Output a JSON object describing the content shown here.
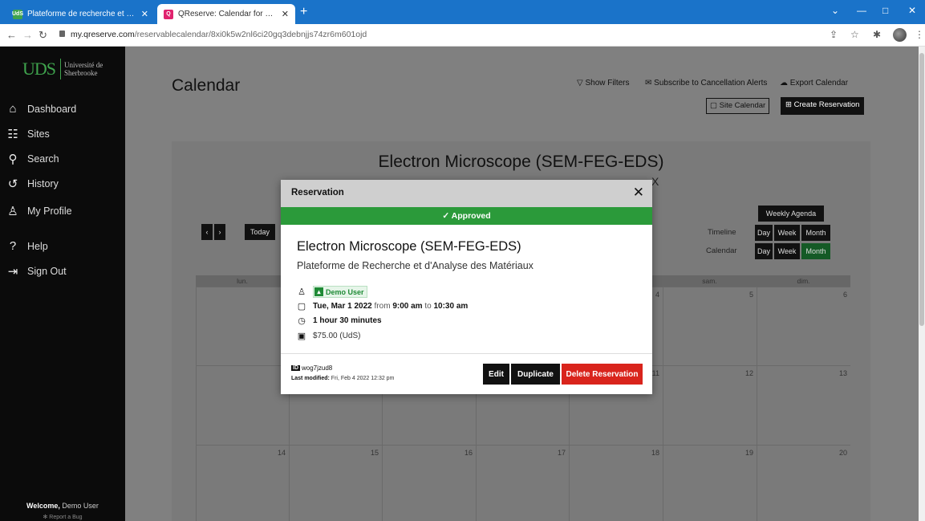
{
  "browser": {
    "tabs": [
      {
        "title": "Plateforme de recherche et d'an",
        "favicon": "UdS"
      },
      {
        "title": "QReserve: Calendar for Electron",
        "favicon": "Q"
      }
    ],
    "url_host": "my.qreserve.com",
    "url_path": "/reservablecalendar/8xi0k5w2nl6ci20gq3debnjjs74zr6m601ojd"
  },
  "sidebar": {
    "logo_mark": "UDS",
    "logo_text": "Université de Sherbrooke",
    "items": [
      {
        "label": "Dashboard",
        "icon": "home-icon"
      },
      {
        "label": "Sites",
        "icon": "sites-icon"
      },
      {
        "label": "Search",
        "icon": "search-icon"
      },
      {
        "label": "History",
        "icon": "history-icon"
      },
      {
        "label": "My Profile",
        "icon": "user-icon"
      },
      {
        "label": "Help",
        "icon": "help-icon"
      },
      {
        "label": "Sign Out",
        "icon": "sign-out-icon"
      }
    ],
    "welcome_prefix": "Welcome,",
    "welcome_user": "Demo User",
    "report_bug": "Report a Bug"
  },
  "header": {
    "title": "Calendar",
    "show_filters": "Show Filters",
    "subscribe": "Subscribe to Cancellation Alerts",
    "export": "Export Calendar",
    "site_calendar": "Site Calendar",
    "create_reservation": "Create Reservation"
  },
  "calendar": {
    "title": "Electron Microscope (SEM-FEG-EDS)",
    "subtitle_fragment": "X",
    "today": "Today",
    "weekly_agenda": "Weekly Agenda",
    "timeline_label": "Timeline",
    "calendar_label": "Calendar",
    "view_day": "Day",
    "view_week": "Week",
    "view_month": "Month",
    "day_headers": [
      "lun.",
      "",
      "",
      "",
      "",
      "sam.",
      "dim."
    ],
    "week1": [
      "",
      "",
      "",
      "4",
      "5",
      "6"
    ],
    "week2": [
      "",
      "",
      "",
      "11",
      "12",
      "13"
    ],
    "week3": [
      "14",
      "15",
      "16",
      "17",
      "18",
      "19",
      "20"
    ]
  },
  "modal": {
    "title": "Reservation",
    "status": "Approved",
    "reservable": "Electron Microscope (SEM-FEG-EDS)",
    "site": "Plateforme de Recherche et d'Analyse des Matériaux",
    "user": "Demo User",
    "date": "Tue, Mar 1 2022",
    "from_word": "from",
    "start": "9:00 am",
    "to_word": "to",
    "end": "10:30 am",
    "duration": "1 hour 30 minutes",
    "price": "$75.00 (UdS)",
    "id_label": "ID",
    "id_value": "wog7jzud8",
    "modified_label": "Last modified:",
    "modified_value": "Fri, Feb 4 2022 12:32 pm",
    "edit": "Edit",
    "duplicate": "Duplicate",
    "delete": "Delete Reservation",
    "colors": {
      "approved": "#2b9a3a",
      "delete": "#d9241c"
    }
  }
}
